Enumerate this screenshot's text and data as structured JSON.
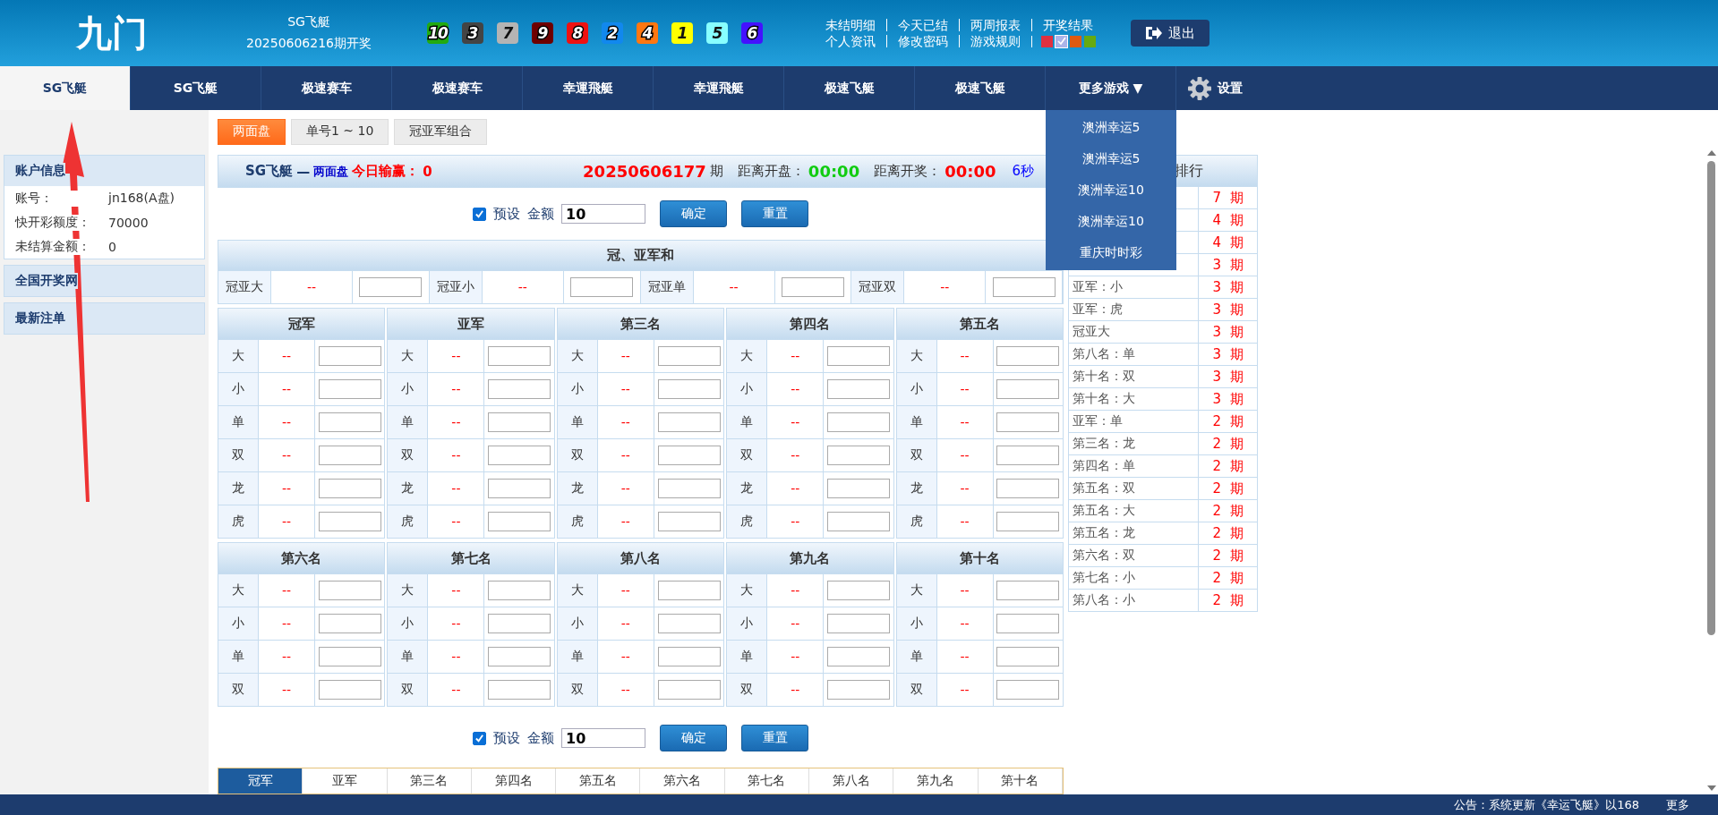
{
  "header": {
    "logo": "九门",
    "game": "SG飞艇",
    "draw": "20250606216期开奖",
    "balls": [
      {
        "number": "10",
        "color": "#22aa11"
      },
      {
        "number": "3",
        "color": "#444444"
      },
      {
        "number": "7",
        "color": "#b4b4b4"
      },
      {
        "number": "9",
        "color": "#6e0000"
      },
      {
        "number": "8",
        "color": "#ee1111"
      },
      {
        "number": "2",
        "color": "#1188ee"
      },
      {
        "number": "4",
        "color": "#ff7711"
      },
      {
        "number": "1",
        "color": "#ffff00"
      },
      {
        "number": "5",
        "color": "#88ffff"
      },
      {
        "number": "6",
        "color": "#4411ff"
      }
    ],
    "links_row1": [
      "未结明细",
      "今天已结",
      "两周报表",
      "开奖结果"
    ],
    "links_row2": [
      "个人资讯",
      "修改密码",
      "游戏规则"
    ],
    "themes": [
      {
        "color": "#e03040",
        "selected": false
      },
      {
        "color": "#aab4e8",
        "selected": true
      },
      {
        "color": "#e05a10",
        "selected": false
      },
      {
        "color": "#66aa11",
        "selected": false
      }
    ],
    "logout": "退出"
  },
  "nav": {
    "tabs": [
      {
        "label": "SG飞艇",
        "selected": true
      },
      {
        "label": "SG飞艇",
        "selected": false
      },
      {
        "label": "极速赛车",
        "selected": false
      },
      {
        "label": "极速赛车",
        "selected": false
      },
      {
        "label": "幸運飛艇",
        "selected": false
      },
      {
        "label": "幸運飛艇",
        "selected": false
      },
      {
        "label": "极速飞艇",
        "selected": false
      },
      {
        "label": "极速飞艇",
        "selected": false
      }
    ],
    "more": {
      "label": "更多游戏",
      "arrow": "▼",
      "expanded": true,
      "items": [
        "澳洲幸运5",
        "澳洲幸运5",
        "澳洲幸运10",
        "澳洲幸运10",
        "重庆时时彩"
      ]
    },
    "settings": "设置"
  },
  "subtabs": [
    {
      "label": "两面盘",
      "selected": true
    },
    {
      "label": "单号1 ~ 10",
      "selected": false
    },
    {
      "label": "冠亚军组合",
      "selected": false
    }
  ],
  "sidebar": {
    "account": {
      "title": "账户信息",
      "rows": [
        {
          "label": "账号：",
          "value": "jn168(A盘)"
        },
        {
          "label": "快开彩额度：",
          "value": "70000"
        },
        {
          "label": "未结算金额：",
          "value": "0"
        }
      ]
    },
    "panels": [
      "全国开奖网",
      "最新注单"
    ]
  },
  "board": {
    "game": "SG飞艇",
    "dash": "—",
    "mode": "两面盘",
    "pnl_label": "今日输赢：",
    "pnl": "0",
    "period": "20250606177",
    "period_suffix": "期",
    "open_label": "距离开盘：",
    "open_time": "00:00",
    "draw_label": "距离开奖：",
    "draw_time": "00:00",
    "refresh": "6秒"
  },
  "controls": [
    {
      "preset_label": "预设",
      "preset_checked": true,
      "amount_label": "金额",
      "amount": "10",
      "confirm": "确定",
      "reset": "重置"
    },
    {
      "preset_label": "预设",
      "preset_checked": true,
      "amount_label": "金额",
      "amount": "10",
      "confirm": "确定",
      "reset": "重置"
    }
  ],
  "sum": {
    "title": "冠、亚军和",
    "cells": [
      {
        "label": "冠亚大",
        "odds": "--"
      },
      {
        "label": "冠亚小",
        "odds": "--"
      },
      {
        "label": "冠亚单",
        "odds": "--"
      },
      {
        "label": "冠亚双",
        "odds": "--"
      }
    ]
  },
  "groups": [
    {
      "columns": [
        {
          "title": "冠军",
          "rows": [
            {
              "label": "大",
              "odds": "--"
            },
            {
              "label": "小",
              "odds": "--"
            },
            {
              "label": "单",
              "odds": "--"
            },
            {
              "label": "双",
              "odds": "--"
            },
            {
              "label": "龙",
              "odds": "--"
            },
            {
              "label": "虎",
              "odds": "--"
            }
          ]
        },
        {
          "title": "亚军",
          "rows": [
            {
              "label": "大",
              "odds": "--"
            },
            {
              "label": "小",
              "odds": "--"
            },
            {
              "label": "单",
              "odds": "--"
            },
            {
              "label": "双",
              "odds": "--"
            },
            {
              "label": "龙",
              "odds": "--"
            },
            {
              "label": "虎",
              "odds": "--"
            }
          ]
        },
        {
          "title": "第三名",
          "rows": [
            {
              "label": "大",
              "odds": "--"
            },
            {
              "label": "小",
              "odds": "--"
            },
            {
              "label": "单",
              "odds": "--"
            },
            {
              "label": "双",
              "odds": "--"
            },
            {
              "label": "龙",
              "odds": "--"
            },
            {
              "label": "虎",
              "odds": "--"
            }
          ]
        },
        {
          "title": "第四名",
          "rows": [
            {
              "label": "大",
              "odds": "--"
            },
            {
              "label": "小",
              "odds": "--"
            },
            {
              "label": "单",
              "odds": "--"
            },
            {
              "label": "双",
              "odds": "--"
            },
            {
              "label": "龙",
              "odds": "--"
            },
            {
              "label": "虎",
              "odds": "--"
            }
          ]
        },
        {
          "title": "第五名",
          "rows": [
            {
              "label": "大",
              "odds": "--"
            },
            {
              "label": "小",
              "odds": "--"
            },
            {
              "label": "单",
              "odds": "--"
            },
            {
              "label": "双",
              "odds": "--"
            },
            {
              "label": "龙",
              "odds": "--"
            },
            {
              "label": "虎",
              "odds": "--"
            }
          ]
        }
      ]
    },
    {
      "columns": [
        {
          "title": "第六名",
          "rows": [
            {
              "label": "大",
              "odds": "--"
            },
            {
              "label": "小",
              "odds": "--"
            },
            {
              "label": "单",
              "odds": "--"
            },
            {
              "label": "双",
              "odds": "--"
            }
          ]
        },
        {
          "title": "第七名",
          "rows": [
            {
              "label": "大",
              "odds": "--"
            },
            {
              "label": "小",
              "odds": "--"
            },
            {
              "label": "单",
              "odds": "--"
            },
            {
              "label": "双",
              "odds": "--"
            }
          ]
        },
        {
          "title": "第八名",
          "rows": [
            {
              "label": "大",
              "odds": "--"
            },
            {
              "label": "小",
              "odds": "--"
            },
            {
              "label": "单",
              "odds": "--"
            },
            {
              "label": "双",
              "odds": "--"
            }
          ]
        },
        {
          "title": "第九名",
          "rows": [
            {
              "label": "大",
              "odds": "--"
            },
            {
              "label": "小",
              "odds": "--"
            },
            {
              "label": "单",
              "odds": "--"
            },
            {
              "label": "双",
              "odds": "--"
            }
          ]
        },
        {
          "title": "第十名",
          "rows": [
            {
              "label": "大",
              "odds": "--"
            },
            {
              "label": "小",
              "odds": "--"
            },
            {
              "label": "单",
              "odds": "--"
            },
            {
              "label": "双",
              "odds": "--"
            }
          ]
        }
      ]
    }
  ],
  "ranking": {
    "title": "排行",
    "rows": [
      {
        "count": "7",
        "unit": "期"
      },
      {
        "count": "4",
        "unit": "期"
      },
      {
        "count": "4",
        "unit": "期"
      },
      {
        "count": "3",
        "unit": "期"
      },
      {
        "item": "亚军：小",
        "count": "3",
        "unit": "期"
      },
      {
        "item": "亚军：虎",
        "count": "3",
        "unit": "期"
      },
      {
        "item": "冠亚大",
        "count": "3",
        "unit": "期"
      },
      {
        "item": "第八名：单",
        "count": "3",
        "unit": "期"
      },
      {
        "item": "第十名：双",
        "count": "3",
        "unit": "期"
      },
      {
        "item": "第十名：大",
        "count": "3",
        "unit": "期"
      },
      {
        "item": "亚军：单",
        "count": "2",
        "unit": "期"
      },
      {
        "item": "第三名：龙",
        "count": "2",
        "unit": "期"
      },
      {
        "item": "第四名：单",
        "count": "2",
        "unit": "期"
      },
      {
        "item": "第五名：双",
        "count": "2",
        "unit": "期"
      },
      {
        "item": "第五名：大",
        "count": "2",
        "unit": "期"
      },
      {
        "item": "第五名：龙",
        "count": "2",
        "unit": "期"
      },
      {
        "item": "第六名：双",
        "count": "2",
        "unit": "期"
      },
      {
        "item": "第七名：小",
        "count": "2",
        "unit": "期"
      },
      {
        "item": "第八名：小",
        "count": "2",
        "unit": "期"
      }
    ]
  },
  "bottom_tabs": [
    {
      "label": "冠军",
      "selected": true
    },
    {
      "label": "亚军",
      "selected": false
    },
    {
      "label": "第三名",
      "selected": false
    },
    {
      "label": "第四名",
      "selected": false
    },
    {
      "label": "第五名",
      "selected": false
    },
    {
      "label": "第六名",
      "selected": false
    },
    {
      "label": "第七名",
      "selected": false
    },
    {
      "label": "第八名",
      "selected": false
    },
    {
      "label": "第九名",
      "selected": false
    },
    {
      "label": "第十名",
      "selected": false
    }
  ],
  "footer": {
    "notice": "公告：系统更新《幸运飞艇》以168",
    "more": "更多"
  }
}
